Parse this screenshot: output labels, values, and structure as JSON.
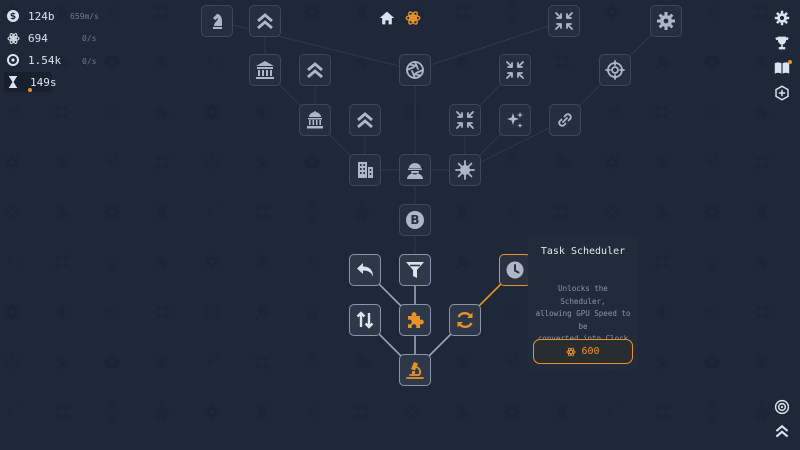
{
  "resources": {
    "money": {
      "icon": "dollar-coin-icon",
      "value": "124b",
      "rate": "659m/s"
    },
    "atoms": {
      "icon": "atom-icon",
      "value": "694",
      "rate": "0/s"
    },
    "clock": {
      "icon": "clock-speed-icon",
      "value": "1.54k",
      "rate": "0/s"
    },
    "timer": {
      "icon": "hourglass-icon",
      "value": "149s"
    }
  },
  "top_tabs": [
    {
      "name": "home",
      "icon": "home-icon",
      "active": false
    },
    {
      "name": "research",
      "icon": "atom-icon",
      "active": true
    }
  ],
  "right_toolbar": [
    {
      "name": "settings",
      "icon": "gear-icon"
    },
    {
      "name": "achievements",
      "icon": "trophy-icon"
    },
    {
      "name": "guide",
      "icon": "book-icon",
      "notification": true
    },
    {
      "name": "prestige",
      "icon": "hexagon-icon"
    }
  ],
  "bottom_right": [
    {
      "name": "target",
      "icon": "target-icon"
    },
    {
      "name": "collapse",
      "icon": "double-chevron-up-icon"
    }
  ],
  "tooltip": {
    "title": "Task Scheduler",
    "description_lines": [
      "Unlocks the Scheduler,",
      "allowing GPU Speed to be",
      "converted into Clock Speed"
    ],
    "cost_icon": "atom-icon",
    "cost": "600"
  },
  "colors": {
    "background": "#1f2838",
    "accent": "#e8932a",
    "node_border": "#3d4759",
    "node_owned_border": "#8896ab"
  },
  "tree": {
    "nodes": [
      {
        "name": "node-knight",
        "icon": "chess-knight-icon",
        "state": "locked"
      },
      {
        "name": "node-chevrons-top",
        "icon": "double-chevron-up-icon",
        "state": "locked"
      },
      {
        "name": "node-compress-top",
        "icon": "compress-arrows-icon",
        "state": "locked"
      },
      {
        "name": "node-gear-top",
        "icon": "gear-icon",
        "state": "locked"
      },
      {
        "name": "node-bank",
        "icon": "bank-icon",
        "state": "locked"
      },
      {
        "name": "node-chevrons-a",
        "icon": "double-chevron-up-icon",
        "state": "locked"
      },
      {
        "name": "node-aperture",
        "icon": "aperture-icon",
        "state": "locked"
      },
      {
        "name": "node-compress-a",
        "icon": "compress-arrows-icon",
        "state": "locked"
      },
      {
        "name": "node-crosshair",
        "icon": "crosshair-icon",
        "state": "locked"
      },
      {
        "name": "node-bank-dome",
        "icon": "bank-dome-icon",
        "state": "locked"
      },
      {
        "name": "node-chevrons-b",
        "icon": "double-chevron-up-icon",
        "state": "locked"
      },
      {
        "name": "node-compress-b",
        "icon": "compress-arrows-icon",
        "state": "locked"
      },
      {
        "name": "node-sparkles",
        "icon": "sparkles-icon",
        "state": "locked"
      },
      {
        "name": "node-link",
        "icon": "link-icon",
        "state": "locked"
      },
      {
        "name": "node-building",
        "icon": "building-icon",
        "state": "locked"
      },
      {
        "name": "node-worker",
        "icon": "worker-icon",
        "state": "locked"
      },
      {
        "name": "node-virus",
        "icon": "virus-icon",
        "state": "locked"
      },
      {
        "name": "node-bitcoin",
        "icon": "bitcoin-icon",
        "state": "locked"
      },
      {
        "name": "node-undo",
        "icon": "undo-arrow-icon",
        "state": "owned"
      },
      {
        "name": "node-filter",
        "icon": "filter-icon",
        "state": "owned"
      },
      {
        "name": "node-scheduler",
        "icon": "clock-icon",
        "state": "selected"
      },
      {
        "name": "node-swap",
        "icon": "swap-arrows-icon",
        "state": "owned"
      },
      {
        "name": "node-puzzle",
        "icon": "puzzle-icon",
        "state": "owned"
      },
      {
        "name": "node-refresh",
        "icon": "refresh-icon",
        "state": "owned"
      },
      {
        "name": "node-microscope",
        "icon": "microscope-icon",
        "state": "owned"
      }
    ]
  }
}
